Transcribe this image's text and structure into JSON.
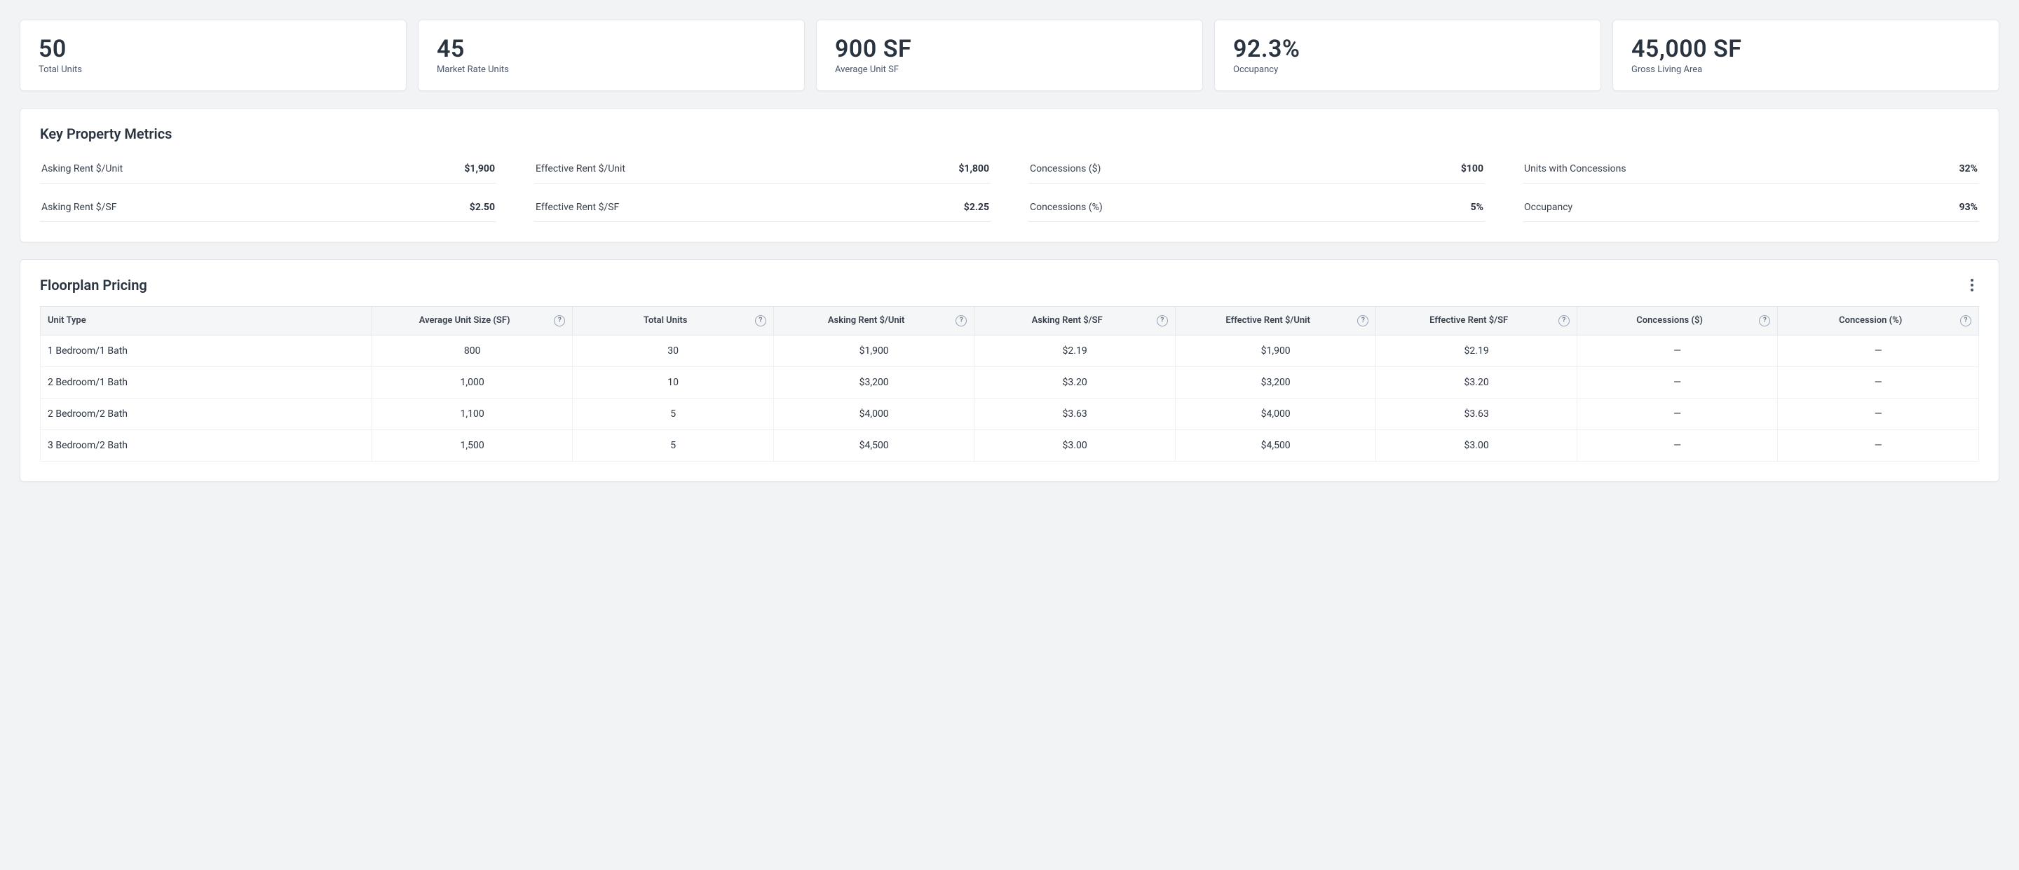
{
  "stats": [
    {
      "value": "50",
      "label": "Total Units"
    },
    {
      "value": "45",
      "label": "Market Rate Units"
    },
    {
      "value": "900 SF",
      "label": "Average Unit SF"
    },
    {
      "value": "92.3%",
      "label": "Occupancy"
    },
    {
      "value": "45,000 SF",
      "label": "Gross Living Area"
    }
  ],
  "key_metrics": {
    "title": "Key Property Metrics",
    "cells": [
      {
        "label": "Asking Rent $/Unit",
        "value": "$1,900"
      },
      {
        "label": "Effective Rent $/Unit",
        "value": "$1,800"
      },
      {
        "label": "Concessions ($)",
        "value": "$100"
      },
      {
        "label": "Units with Concessions",
        "value": "32%"
      },
      {
        "label": "Asking Rent $/SF",
        "value": "$2.50"
      },
      {
        "label": "Effective Rent $/SF",
        "value": "$2.25"
      },
      {
        "label": "Concessions (%)",
        "value": "5%"
      },
      {
        "label": "Occupancy",
        "value": "93%"
      }
    ]
  },
  "floorplan": {
    "title": "Floorplan Pricing",
    "headers": [
      "Unit Type",
      "Average Unit Size (SF)",
      "Total Units",
      "Asking Rent $/Unit",
      "Asking Rent $/SF",
      "Effective Rent $/Unit",
      "Effective Rent $/SF",
      "Concessions ($)",
      "Concession (%)"
    ],
    "rows": [
      [
        "1 Bedroom/1 Bath",
        "800",
        "30",
        "$1,900",
        "$2.19",
        "$1,900",
        "$2.19",
        "—",
        "—"
      ],
      [
        "2 Bedroom/1 Bath",
        "1,000",
        "10",
        "$3,200",
        "$3.20",
        "$3,200",
        "$3.20",
        "—",
        "—"
      ],
      [
        "2 Bedroom/2 Bath",
        "1,100",
        "5",
        "$4,000",
        "$3.63",
        "$4,000",
        "$3.63",
        "—",
        "—"
      ],
      [
        "3 Bedroom/2 Bath",
        "1,500",
        "5",
        "$4,500",
        "$3.00",
        "$4,500",
        "$3.00",
        "—",
        "—"
      ]
    ]
  }
}
